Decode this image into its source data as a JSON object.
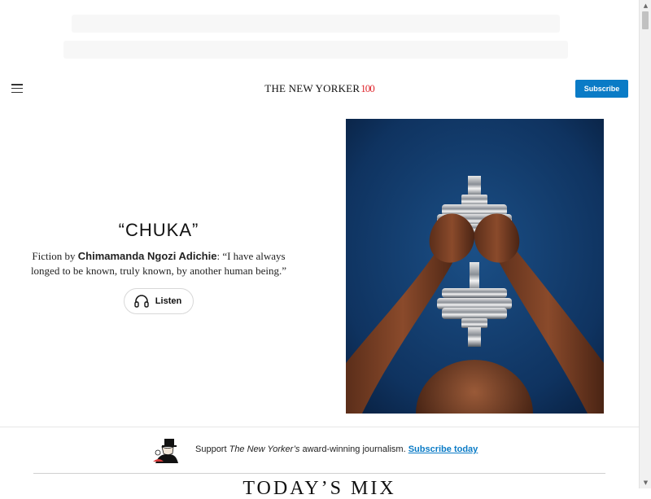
{
  "header": {
    "logo_text": "THE NEW YORKER",
    "logo_centennial": "100",
    "subscribe_label": "Subscribe"
  },
  "hero": {
    "title": "“CHUKA”",
    "dek_prefix": "Fiction by ",
    "dek_author": "Chimamanda Ngozi Adichie",
    "dek_suffix": ": “I have always longed to be known, truly known, by another human being.”",
    "listen_label": "Listen",
    "image_description_icon": "dumbbell-photo"
  },
  "support": {
    "text_prefix": "Support ",
    "publication": "The New Yorker’s",
    "text_suffix": " award-winning journalism. ",
    "link_label": "Subscribe today"
  },
  "section": {
    "heading": "TODAY’S MIX"
  },
  "colors": {
    "accent_blue": "#0a7bc6",
    "centennial_red": "#e0282f",
    "photo_background": "#0f3360"
  },
  "icons": {
    "menu": "hamburger-menu-icon",
    "listen": "headphones-icon",
    "support_logo": "eustace-tilley-icon"
  }
}
